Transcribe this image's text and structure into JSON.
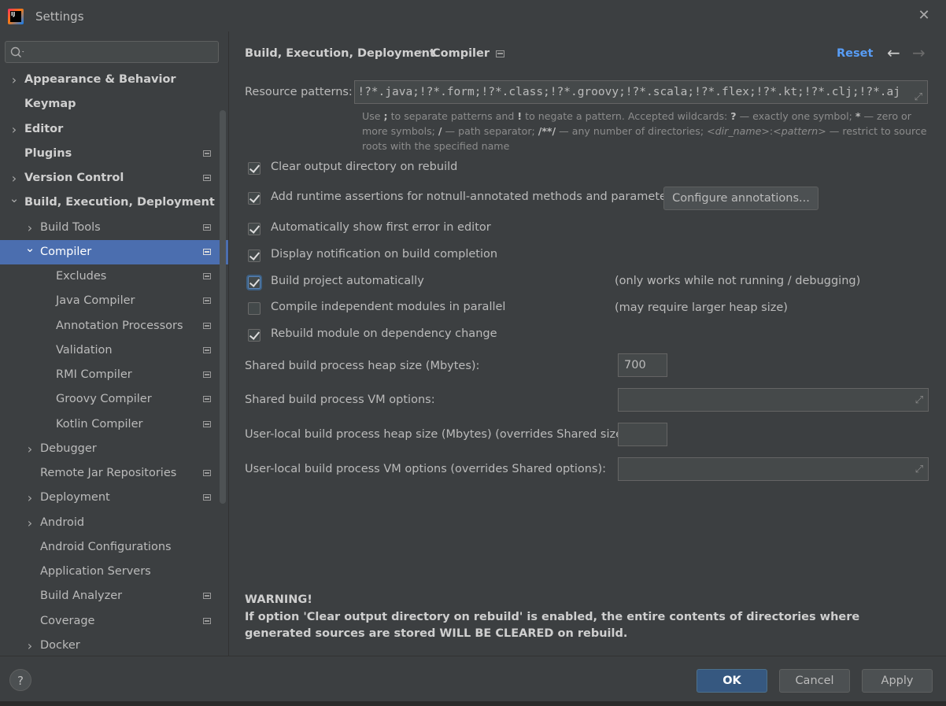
{
  "window": {
    "title": "Settings",
    "app_logo": "IJ",
    "close_icon": "close-icon"
  },
  "sidebar": {
    "search": {
      "value": "",
      "placeholder": ""
    },
    "items": [
      {
        "label": "Appearance & Behavior",
        "level": 0,
        "expandable": true,
        "expanded": false,
        "bold": true,
        "project_icon": false,
        "selected": false
      },
      {
        "label": "Keymap",
        "level": 0,
        "expandable": false,
        "bold": true,
        "project_icon": false,
        "selected": false
      },
      {
        "label": "Editor",
        "level": 0,
        "expandable": true,
        "expanded": false,
        "bold": true,
        "project_icon": false,
        "selected": false
      },
      {
        "label": "Plugins",
        "level": 0,
        "expandable": false,
        "bold": true,
        "project_icon": true,
        "selected": false
      },
      {
        "label": "Version Control",
        "level": 0,
        "expandable": true,
        "expanded": false,
        "bold": true,
        "project_icon": true,
        "selected": false
      },
      {
        "label": "Build, Execution, Deployment",
        "level": 0,
        "expandable": true,
        "expanded": true,
        "bold": true,
        "project_icon": false,
        "selected": false
      },
      {
        "label": "Build Tools",
        "level": 1,
        "expandable": true,
        "expanded": false,
        "bold": false,
        "project_icon": true,
        "selected": false
      },
      {
        "label": "Compiler",
        "level": 1,
        "expandable": true,
        "expanded": true,
        "bold": false,
        "project_icon": true,
        "selected": true
      },
      {
        "label": "Excludes",
        "level": 2,
        "expandable": false,
        "bold": false,
        "project_icon": true,
        "selected": false
      },
      {
        "label": "Java Compiler",
        "level": 2,
        "expandable": false,
        "bold": false,
        "project_icon": true,
        "selected": false
      },
      {
        "label": "Annotation Processors",
        "level": 2,
        "expandable": false,
        "bold": false,
        "project_icon": true,
        "selected": false
      },
      {
        "label": "Validation",
        "level": 2,
        "expandable": false,
        "bold": false,
        "project_icon": true,
        "selected": false
      },
      {
        "label": "RMI Compiler",
        "level": 2,
        "expandable": false,
        "bold": false,
        "project_icon": true,
        "selected": false
      },
      {
        "label": "Groovy Compiler",
        "level": 2,
        "expandable": false,
        "bold": false,
        "project_icon": true,
        "selected": false
      },
      {
        "label": "Kotlin Compiler",
        "level": 2,
        "expandable": false,
        "bold": false,
        "project_icon": true,
        "selected": false
      },
      {
        "label": "Debugger",
        "level": 1,
        "expandable": true,
        "expanded": false,
        "bold": false,
        "project_icon": false,
        "selected": false
      },
      {
        "label": "Remote Jar Repositories",
        "level": 1,
        "expandable": false,
        "bold": false,
        "project_icon": true,
        "selected": false
      },
      {
        "label": "Deployment",
        "level": 1,
        "expandable": true,
        "expanded": false,
        "bold": false,
        "project_icon": true,
        "selected": false
      },
      {
        "label": "Android",
        "level": 1,
        "expandable": true,
        "expanded": false,
        "bold": false,
        "project_icon": false,
        "selected": false
      },
      {
        "label": "Android Configurations",
        "level": 1,
        "expandable": false,
        "bold": false,
        "project_icon": false,
        "selected": false
      },
      {
        "label": "Application Servers",
        "level": 1,
        "expandable": false,
        "bold": false,
        "project_icon": false,
        "selected": false
      },
      {
        "label": "Build Analyzer",
        "level": 1,
        "expandable": false,
        "bold": false,
        "project_icon": true,
        "selected": false
      },
      {
        "label": "Coverage",
        "level": 1,
        "expandable": false,
        "bold": false,
        "project_icon": true,
        "selected": false
      },
      {
        "label": "Docker",
        "level": 1,
        "expandable": true,
        "expanded": false,
        "bold": false,
        "project_icon": false,
        "selected": false
      }
    ]
  },
  "header": {
    "breadcrumb_parent": "Build, Execution, Deployment",
    "breadcrumb_sep": "›",
    "breadcrumb_current": "Compiler",
    "reset_label": "Reset",
    "back_icon": "←",
    "forward_icon": "→"
  },
  "resource_patterns": {
    "label": "Resource patterns:",
    "value": "!?*.java;!?*.form;!?*.class;!?*.groovy;!?*.scala;!?*.flex;!?*.kt;!?*.clj;!?*.aj"
  },
  "hint": {
    "t1": "Use ",
    "b1": ";",
    "t2": " to separate patterns and ",
    "b2": "!",
    "t3": " to negate a pattern. Accepted wildcards: ",
    "b3": "?",
    "t4": " — exactly one symbol; ",
    "b4": "*",
    "t5": " — zero or more symbols; ",
    "b5": "/",
    "t6": " — path separator; ",
    "b6": "/**/",
    "t7": " — any number of directories; ",
    "i1": "<dir_name>",
    "t8": ":",
    "i2": "<pattern>",
    "t9": " — restrict to source roots with the specified name"
  },
  "options": [
    {
      "label": "Clear output directory on rebuild",
      "checked": true
    },
    {
      "label": "Add runtime assertions for notnull-annotated methods and parameters",
      "checked": true
    },
    {
      "label": "Automatically show first error in editor",
      "checked": true
    },
    {
      "label": "Display notification on build completion",
      "checked": true
    },
    {
      "label": "Build project automatically",
      "checked": true
    },
    {
      "label": "Compile independent modules in parallel",
      "checked": false
    },
    {
      "label": "Rebuild module on dependency change",
      "checked": true
    }
  ],
  "configure_annotations_label": "Configure annotations...",
  "notes": {
    "build_auto": "(only works while not running / debugging)",
    "parallel": "(may require larger heap size)"
  },
  "fields": {
    "shared_heap": {
      "label": "Shared build process heap size (Mbytes):",
      "value": "700"
    },
    "shared_vm": {
      "label": "Shared build process VM options:",
      "value": ""
    },
    "local_heap": {
      "label": "User-local build process heap size (Mbytes) (overrides Shared size):",
      "value": ""
    },
    "local_vm": {
      "label": "User-local build process VM options (overrides Shared options):",
      "value": ""
    }
  },
  "warning": {
    "title": "WARNING!",
    "body": "If option 'Clear output directory on rebuild' is enabled, the entire contents of directories where generated sources are stored WILL BE CLEARED on rebuild."
  },
  "footer": {
    "help": "?",
    "ok": "OK",
    "cancel": "Cancel",
    "apply": "Apply"
  },
  "colors": {
    "background": "#3c3f41",
    "selection": "#4b6eaf",
    "link": "#589df6",
    "primary_button": "#365880"
  }
}
